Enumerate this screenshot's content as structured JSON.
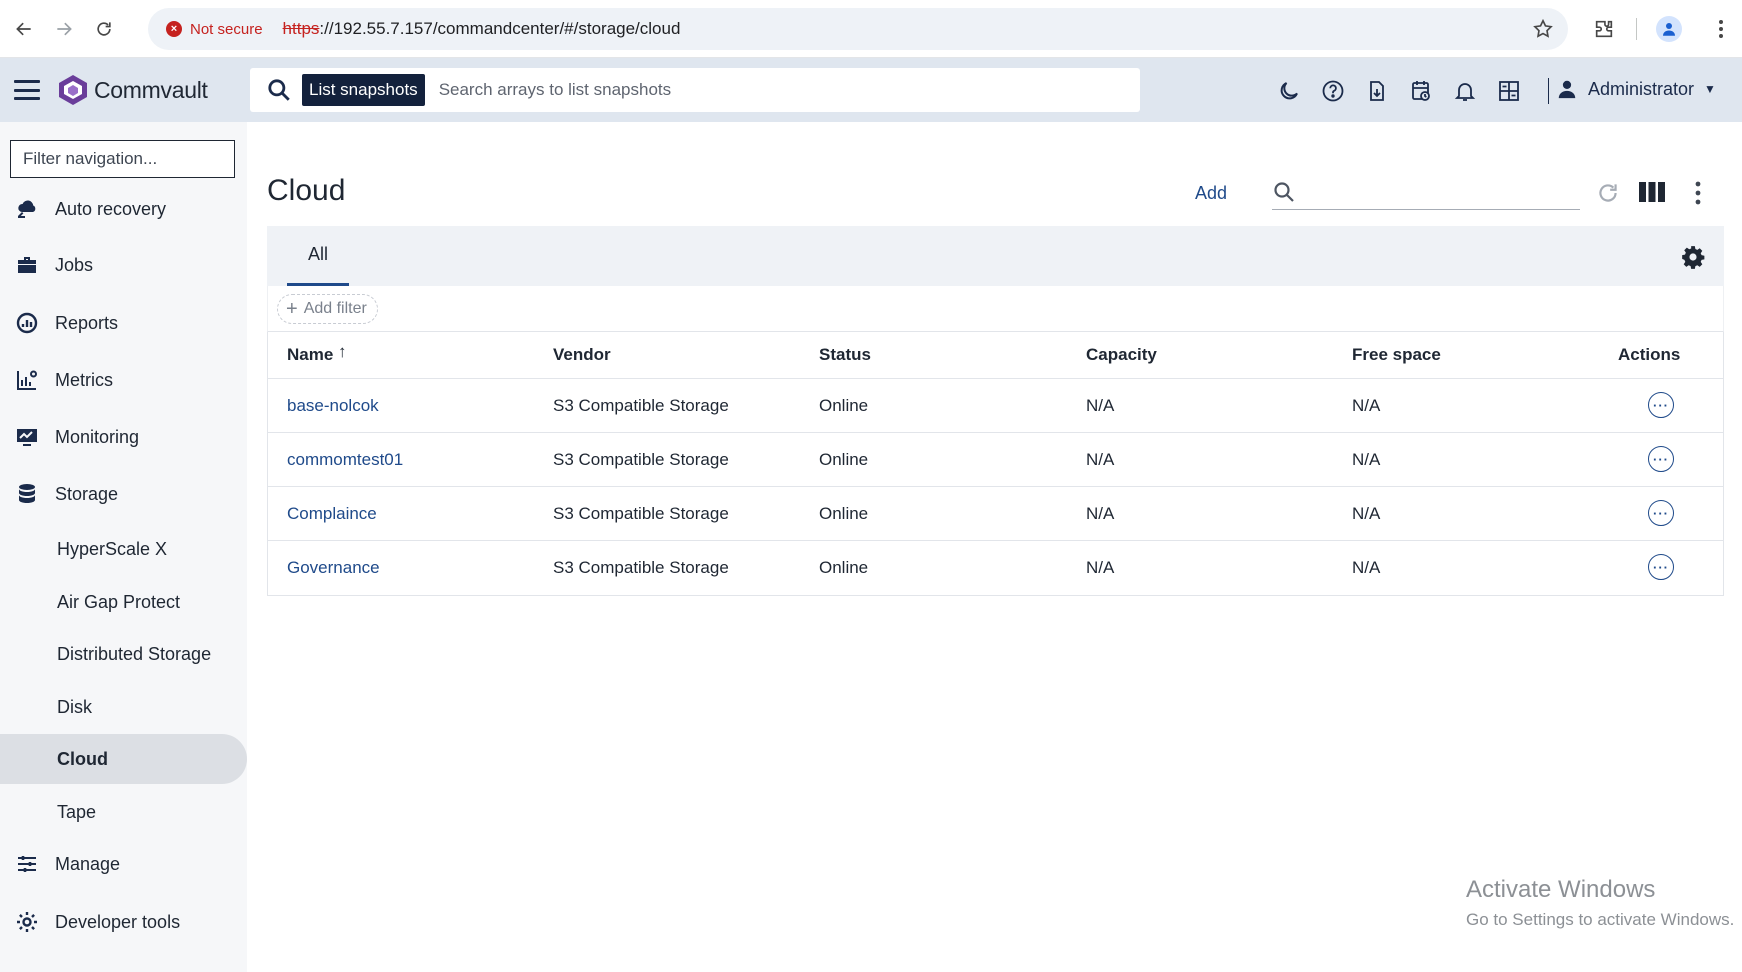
{
  "browser": {
    "security_label": "Not secure",
    "url_proto": "https",
    "url_rest": "://192.55.7.157/commandcenter/#/storage/cloud"
  },
  "app": {
    "brand": "Commvault",
    "search_mode_chip": "List snapshots",
    "search_placeholder": "Search arrays to list snapshots",
    "user_name": "Administrator"
  },
  "sidebar": {
    "filter_placeholder": "Filter navigation...",
    "items": [
      {
        "label": "Auto recovery",
        "icon": "cloud-recovery-icon"
      },
      {
        "label": "Jobs",
        "icon": "briefcase-icon"
      },
      {
        "label": "Reports",
        "icon": "reports-chart-icon"
      },
      {
        "label": "Metrics",
        "icon": "metrics-chart-icon"
      },
      {
        "label": "Monitoring",
        "icon": "monitor-icon"
      },
      {
        "label": "Storage",
        "icon": "database-icon"
      }
    ],
    "storage_children": [
      "HyperScale X",
      "Air Gap Protect",
      "Distributed Storage",
      "Disk",
      "Cloud",
      "Tape"
    ],
    "active_child": "Cloud",
    "bottom_items": [
      {
        "label": "Manage",
        "icon": "sliders-icon"
      },
      {
        "label": "Developer tools",
        "icon": "wrench-gear-icon"
      }
    ]
  },
  "main": {
    "title": "Cloud",
    "add_label": "Add",
    "tab_all": "All",
    "add_filter_label": "Add filter",
    "columns": [
      "Name",
      "Vendor",
      "Status",
      "Capacity",
      "Free space",
      "Actions"
    ],
    "sort_indicator": "↑",
    "rows": [
      {
        "name": "base-nolcok",
        "vendor": "S3 Compatible Storage",
        "status": "Online",
        "capacity": "N/A",
        "free_space": "N/A"
      },
      {
        "name": "commomtest01",
        "vendor": "S3 Compatible Storage",
        "status": "Online",
        "capacity": "N/A",
        "free_space": "N/A"
      },
      {
        "name": "Complaince",
        "vendor": "S3 Compatible Storage",
        "status": "Online",
        "capacity": "N/A",
        "free_space": "N/A"
      },
      {
        "name": "Governance",
        "vendor": "S3 Compatible Storage",
        "status": "Online",
        "capacity": "N/A",
        "free_space": "N/A"
      }
    ]
  },
  "watermark": {
    "line1": "Activate Windows",
    "line2": "Go to Settings to activate Windows."
  },
  "colors": {
    "link": "#1f4a8a",
    "header_bg": "#dfe6ef",
    "chip_bg": "#13213c",
    "danger": "#c5221f"
  }
}
